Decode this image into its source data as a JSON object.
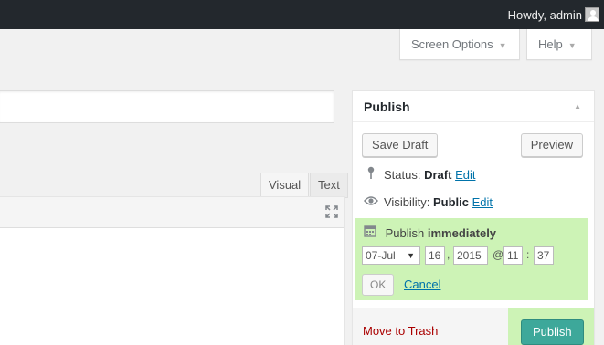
{
  "admin_bar": {
    "howdy": "Howdy, admin"
  },
  "screen_meta": {
    "screen_options": "Screen Options",
    "help": "Help"
  },
  "editor": {
    "tab_visual": "Visual",
    "tab_text": "Text"
  },
  "publish": {
    "title": "Publish",
    "save_draft": "Save Draft",
    "preview": "Preview",
    "status_label": "Status:",
    "status_value": "Draft",
    "status_edit": "Edit",
    "visibility_label": "Visibility:",
    "visibility_value": "Public",
    "visibility_edit": "Edit",
    "schedule_label": "Publish",
    "schedule_value": "immediately",
    "month": "07-Jul",
    "day": "16",
    "year": "2015",
    "at": "@",
    "hour": "11",
    "colon": ":",
    "minute": "37",
    "comma": ",",
    "ok": "OK",
    "cancel": "Cancel",
    "move_to_trash": "Move to Trash",
    "publish_button": "Publish"
  },
  "colors": {
    "admin_bar": "#23282d",
    "highlight": "#cdf3b6",
    "publish_button": "#3da89a",
    "link": "#0073aa",
    "trash": "#aa0000"
  },
  "icons": {
    "status": "pin-icon",
    "visibility": "eye-icon",
    "schedule": "calendar-icon",
    "fullscreen": "expand-icon"
  }
}
